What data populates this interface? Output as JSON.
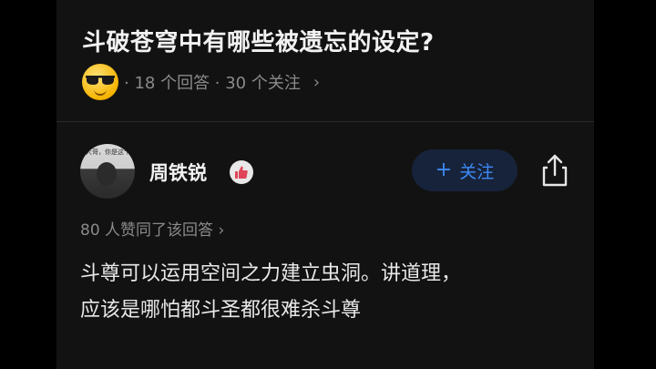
{
  "question": {
    "title": "斗破苍穹中有哪些被遗忘的设定?",
    "meta": "· 18 个回答 · 30 个关注",
    "chevron": "›"
  },
  "author": {
    "name": "周铁锐",
    "avatar_caption": "大哥，你是这个",
    "follow_plus": "+",
    "follow_label": "关注"
  },
  "answer": {
    "agree_text": "80 人赞同了该回答 ›",
    "lines": [
      "斗尊可以运用空间之力建立虫洞。讲道理，",
      "应该是哪怕都斗圣都很难杀斗尊"
    ]
  },
  "icons": {
    "emoji": "sunglasses-emoji-icon",
    "badge": "thumbs-up-badge-icon",
    "share": "share-icon"
  },
  "colors": {
    "accent": "#3d8af7",
    "background": "#121212",
    "badge": "#e0455a"
  }
}
